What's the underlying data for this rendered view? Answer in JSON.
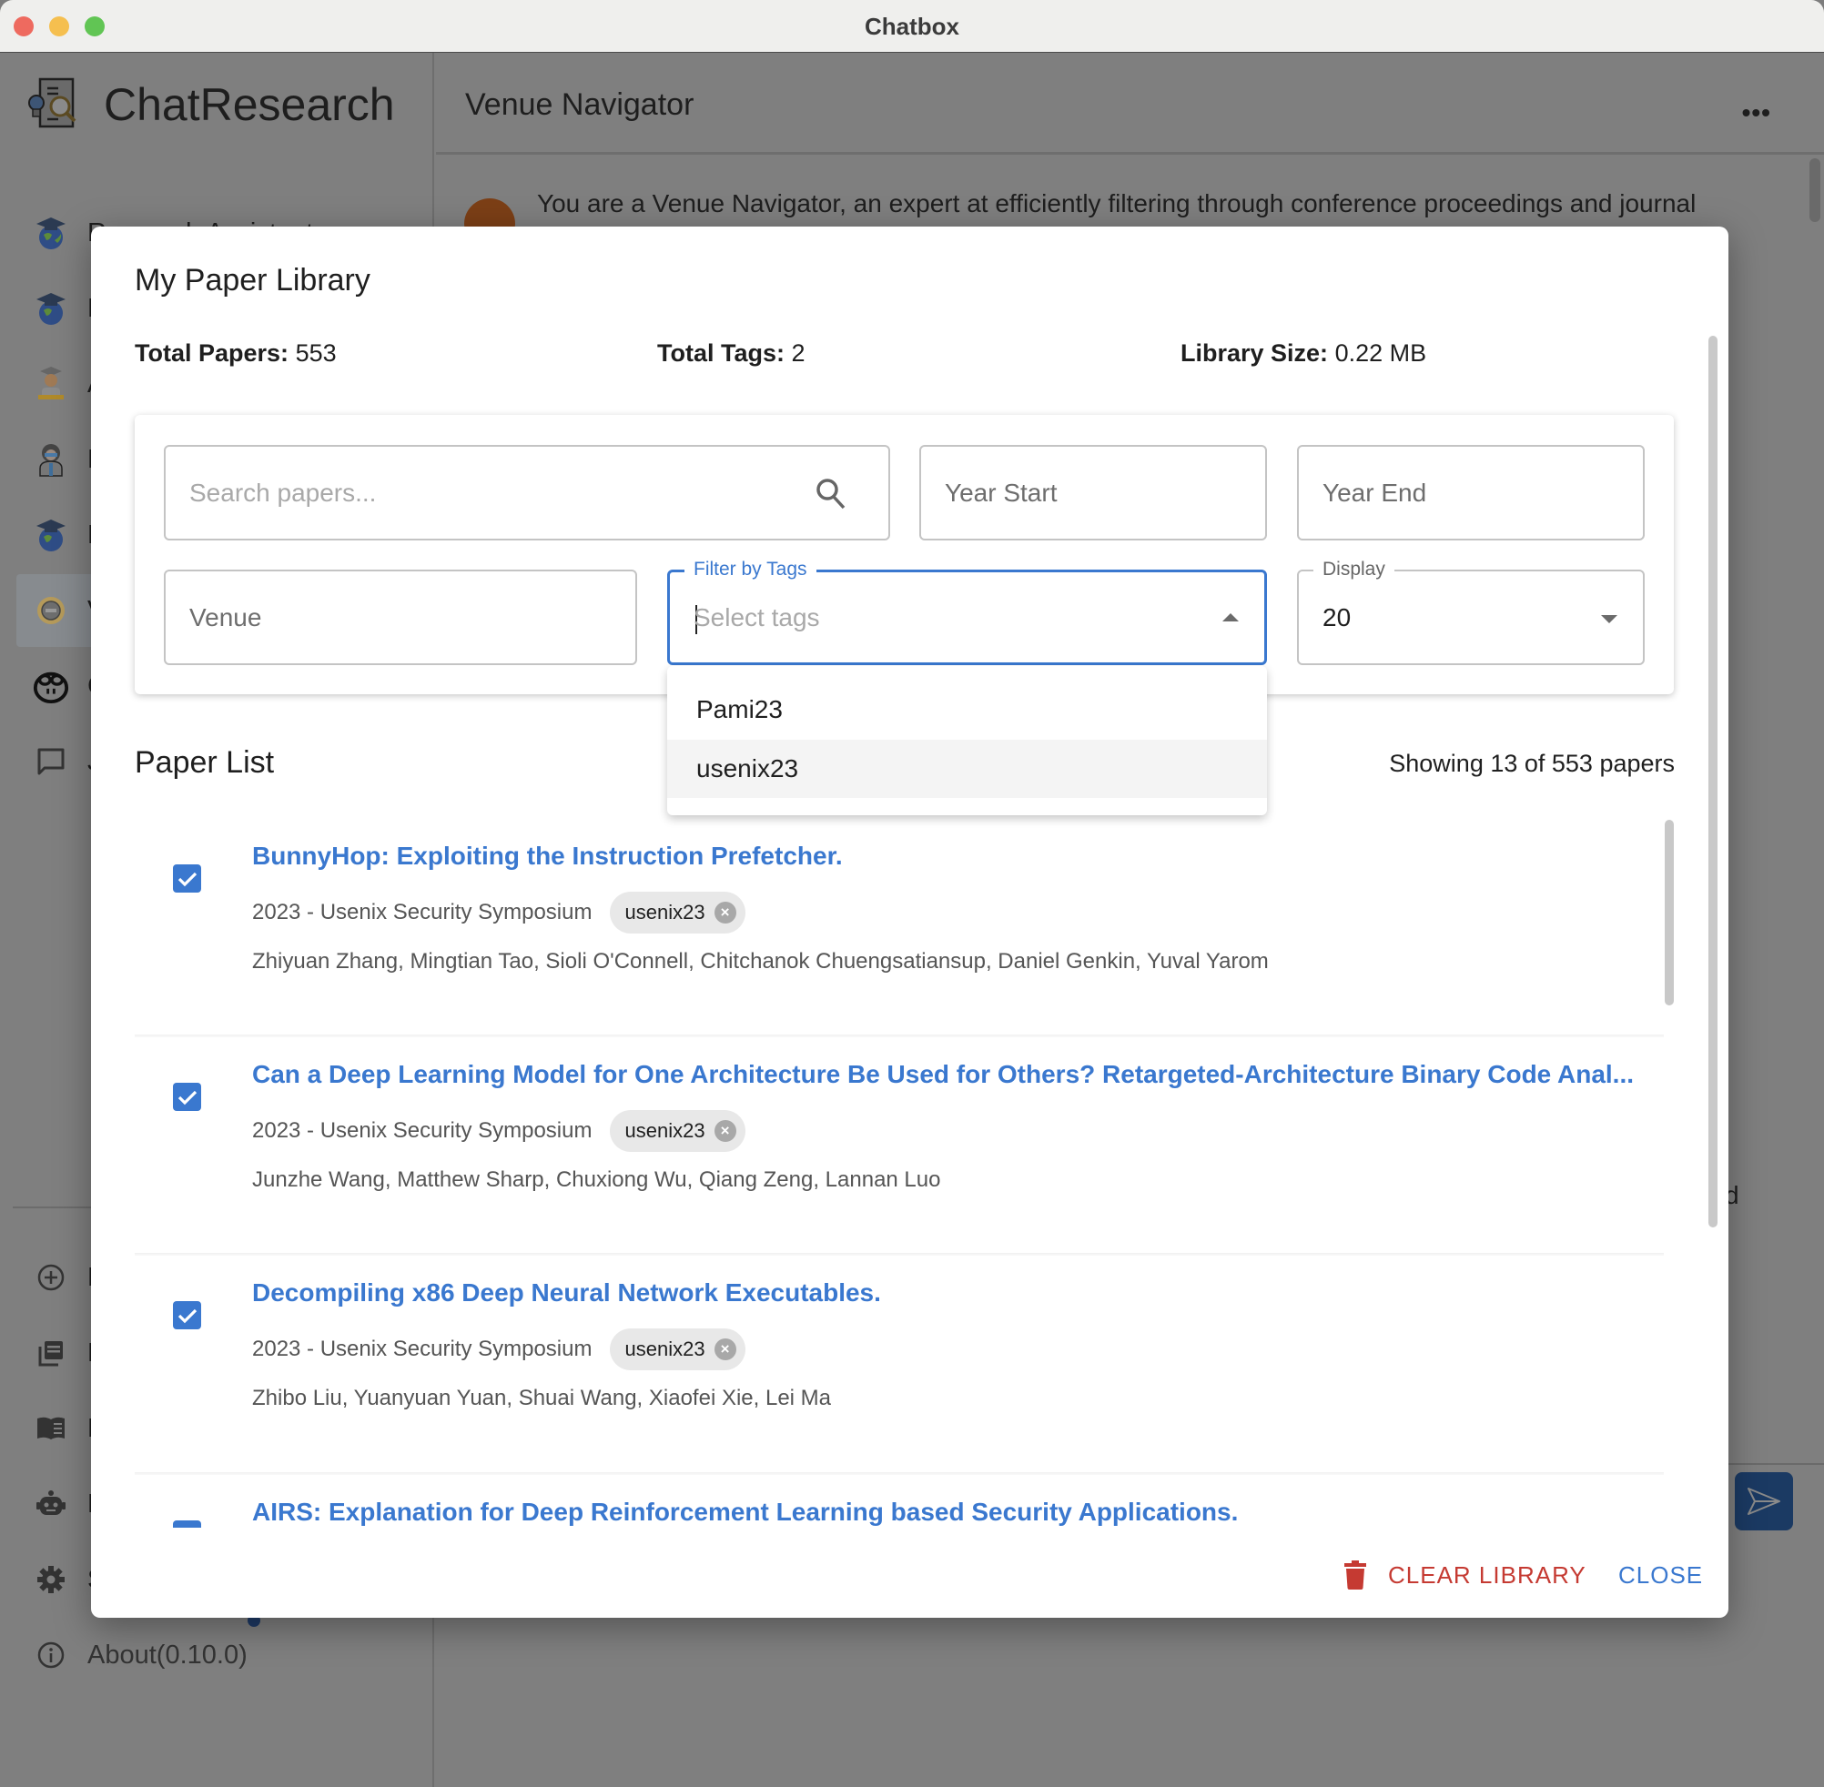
{
  "window": {
    "title": "Chatbox"
  },
  "sidebar": {
    "brand": "ChatResearch",
    "items": [
      {
        "label": "Research Assistant",
        "icon": "graduate-globe-icon"
      },
      {
        "label": "F",
        "icon": "graduate-globe-icon"
      },
      {
        "label": "A",
        "icon": "scholar-avatar-icon"
      },
      {
        "label": "L",
        "icon": "scientist-avatar-icon"
      },
      {
        "label": "F",
        "icon": "graduate-globe-icon"
      },
      {
        "label": "V",
        "icon": "venue-badge-icon",
        "selected": true
      },
      {
        "label": "C",
        "icon": "copilot-icon"
      },
      {
        "label": "J",
        "icon": "chat-bubble-icon"
      }
    ],
    "bottom_items": [
      {
        "label": "N",
        "icon": "add-circle-icon"
      },
      {
        "label": "F",
        "icon": "library-icon"
      },
      {
        "label": "M",
        "icon": "book-icon"
      },
      {
        "label": "M",
        "icon": "robot-icon"
      },
      {
        "label": "S",
        "icon": "gear-icon"
      },
      {
        "label": "About(0.10.0)",
        "icon": "info-icon"
      }
    ]
  },
  "main": {
    "title": "Venue Navigator",
    "more_label": "•••",
    "system_message": "You are a Venue Navigator, an expert at efficiently filtering through conference proceedings and journal",
    "partial_text": "d"
  },
  "dialog": {
    "title": "My Paper Library",
    "stats": [
      {
        "label": "Total Papers:",
        "value": "553"
      },
      {
        "label": "Total Tags:",
        "value": "2"
      },
      {
        "label": "Library Size:",
        "value": "0.22 MB"
      }
    ],
    "filters": {
      "search_placeholder": "Search papers...",
      "year_start_placeholder": "Year Start",
      "year_end_placeholder": "Year End",
      "venue_placeholder": "Venue",
      "tags_label": "Filter by Tags",
      "tags_placeholder": "Select tags",
      "display_label": "Display",
      "display_value": "20"
    },
    "tag_options": [
      "Pami23",
      "usenix23"
    ],
    "list_heading": "Paper List",
    "showing": "Showing 13 of 553 papers",
    "papers": [
      {
        "title": "BunnyHop: Exploiting the Instruction Prefetcher.",
        "venue": "2023 - Usenix Security Symposium",
        "tag": "usenix23",
        "authors": "Zhiyuan Zhang, Mingtian Tao, Sioli O'Connell, Chitchanok Chuengsatiansup, Daniel Genkin, Yuval Yarom",
        "checked": true
      },
      {
        "title": "Can a Deep Learning Model for One Architecture Be Used for Others? Retargeted-Architecture Binary Code Anal...",
        "venue": "2023 - Usenix Security Symposium",
        "tag": "usenix23",
        "authors": "Junzhe Wang, Matthew Sharp, Chuxiong Wu, Qiang Zeng, Lannan Luo",
        "checked": true
      },
      {
        "title": "Decompiling x86 Deep Neural Network Executables.",
        "venue": "2023 - Usenix Security Symposium",
        "tag": "usenix23",
        "authors": "Zhibo Liu, Yuanyuan Yuan, Shuai Wang, Xiaofei Xie, Lei Ma",
        "checked": true
      },
      {
        "title": "AIRS: Explanation for Deep Reinforcement Learning based Security Applications.",
        "venue": "",
        "tag": "",
        "authors": "",
        "checked": true
      }
    ],
    "chip_delete_glyph": "×",
    "clear_label": "CLEAR LIBRARY",
    "close_label": "CLOSE"
  },
  "colors": {
    "accent": "#3a78cf",
    "danger": "#c53a32",
    "send_button": "#1b3a63"
  }
}
